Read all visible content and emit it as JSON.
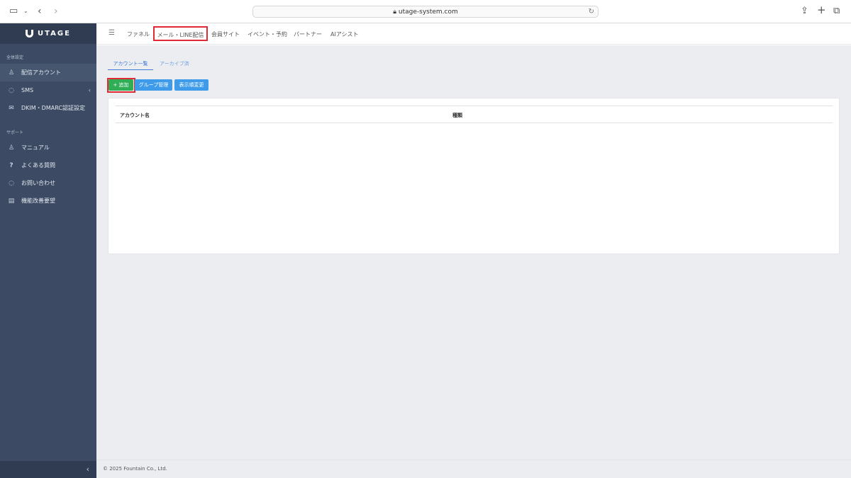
{
  "browser": {
    "url": "utage-system.com"
  },
  "sidebar": {
    "logo_text": "UTAGE",
    "sections": [
      {
        "label": "全体設定",
        "items": [
          {
            "label": "配信アカウント",
            "icon": "user-icon",
            "active": true
          },
          {
            "label": "SMS",
            "icon": "chat-icon",
            "chevron": "‹"
          },
          {
            "label": "DKIM・DMARC認証設定",
            "icon": "mail-icon"
          }
        ]
      },
      {
        "label": "サポート",
        "items": [
          {
            "label": "マニュアル",
            "icon": "user-icon"
          },
          {
            "label": "よくある質問",
            "icon": "question-icon"
          },
          {
            "label": "お問い合わせ",
            "icon": "chat-icon"
          },
          {
            "label": "機能改善要望",
            "icon": "document-icon"
          }
        ]
      }
    ],
    "collapse_glyph": "‹"
  },
  "topnav": {
    "items": [
      "ファネル",
      "メール・LINE配信",
      "会員サイト",
      "イベント・予約",
      "パートナー",
      "AIアシスト"
    ]
  },
  "main": {
    "tabs": [
      "アカウント一覧",
      "アーカイブ済"
    ],
    "buttons": {
      "add": "+ 追加",
      "group": "グループ管理",
      "order": "表示順変更"
    },
    "table": {
      "columns": [
        "アカウント名",
        "種類"
      ]
    }
  },
  "footer": {
    "copyright": "© 2025 Fountain Co., Ltd."
  },
  "colors": {
    "sidebar": "#3c4b63",
    "accent": "#3d7bd6",
    "add_button": "#2fae55",
    "highlight": "#e12a36"
  }
}
